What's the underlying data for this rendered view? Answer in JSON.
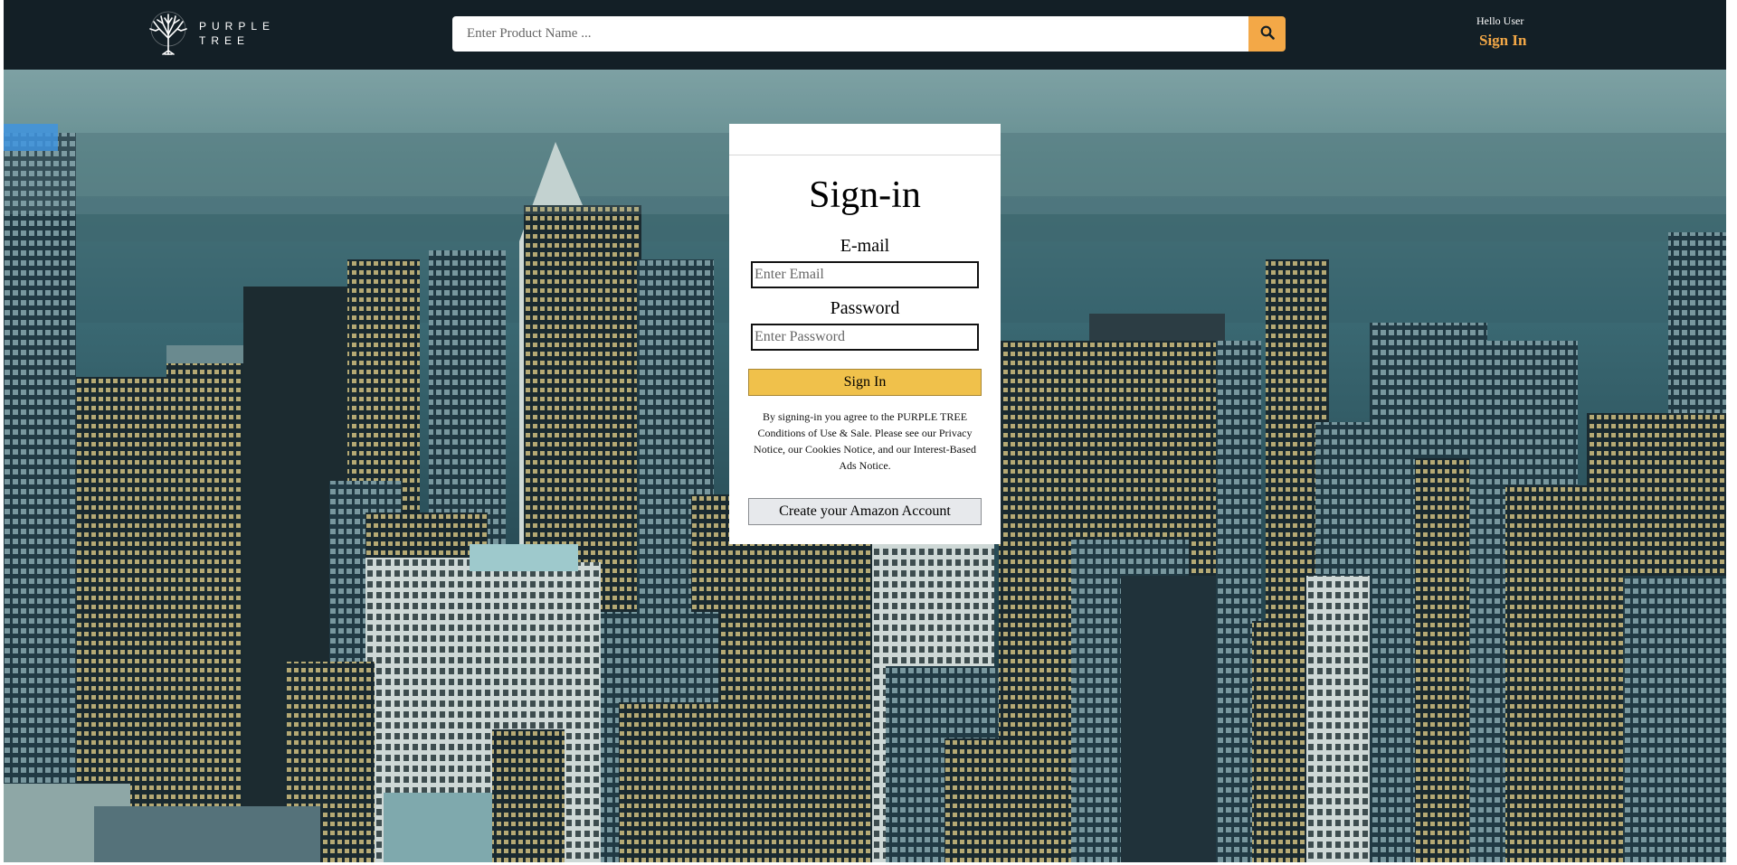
{
  "header": {
    "logo": {
      "line1": "PURPLE",
      "line2": "TREE",
      "icon": "tree-logo-icon"
    },
    "search": {
      "placeholder": "Enter Product Name ...",
      "value": "",
      "button_icon": "search-icon"
    },
    "user": {
      "greeting": "Hello User",
      "signin_label": "Sign In"
    }
  },
  "signin_form": {
    "title": "Sign-in",
    "email_label": "E-mail",
    "email_placeholder": "Enter Email",
    "email_value": "",
    "password_label": "Password",
    "password_placeholder": "Enter Password",
    "password_value": "",
    "submit_label": "Sign In",
    "terms": "By signing-in you agree to the PURPLE TREE Conditions of Use & Sale. Please see our Privacy Notice, our Cookies Notice, and our Interest-Based Ads Notice.",
    "create_account_label": "Create your Amazon Account"
  },
  "colors": {
    "header_bg": "#131f26",
    "accent": "#f3a847",
    "signin_button": "#f0c14b",
    "create_button": "#e7e9ec"
  }
}
